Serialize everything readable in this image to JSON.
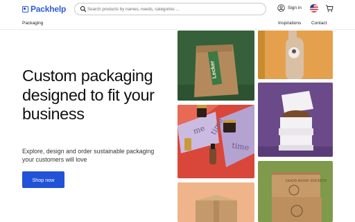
{
  "header": {
    "logo_text": "Packhelp",
    "search": {
      "placeholder": "Search products by names, needs, categories ..."
    },
    "sign_in": "Sign in",
    "nav_left": "Packaging",
    "nav_right": [
      "Inspirations",
      "Contact"
    ],
    "icons": [
      "search-icon",
      "user-icon",
      "us-flag-icon",
      "cart-icon"
    ]
  },
  "hero": {
    "title": "Custom packaging designed to fit your business",
    "subtitle": "Explore, design and order sustainable packaging your customers will love",
    "cta": "Shop now"
  },
  "gallery": {
    "bag_label": "Lecker",
    "box_labels": [
      "me",
      "time",
      "time"
    ],
    "crate_label": "GOOD BONE SOCIETY"
  },
  "colors": {
    "brand_blue": "#2d5bd7",
    "button_blue": "#2252d8"
  }
}
